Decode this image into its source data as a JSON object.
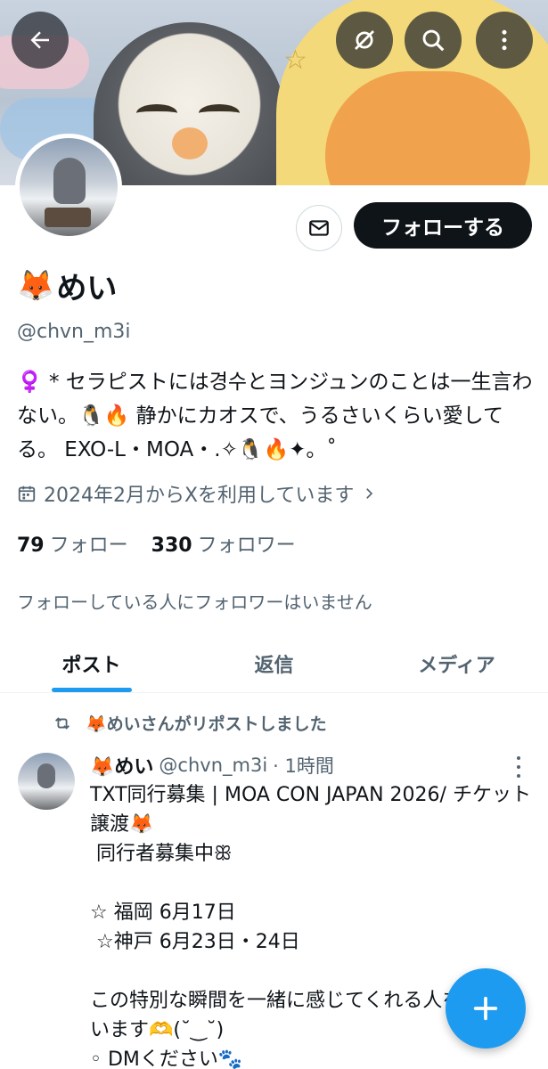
{
  "header": {
    "back_icon": "arrow-left-icon",
    "mute_icon": "slashed-circle-icon",
    "search_icon": "search-icon",
    "more_icon": "more-vertical-icon"
  },
  "profile": {
    "emoji": "🦊",
    "display_name": "めい",
    "handle": "@chvn_m3i",
    "follow_label": "フォローする",
    "message_icon": "mail-icon",
    "bio": "♀️ * セラピストには경수とヨンジュンのことは一生言わない。🐧🔥 静かにカオスで、うるさいくらい愛してる。 EXO-L・MOA・.✧🐧🔥✦。˚",
    "joined": "2024年2月からXを利用しています",
    "following_count": "79",
    "following_label": "フォロー",
    "followers_count": "330",
    "followers_label": "フォロワー",
    "no_mutual": "フォローしている人にフォロワーはいません"
  },
  "tabs": [
    {
      "label": "ポスト"
    },
    {
      "label": "返信"
    },
    {
      "label": "メディア"
    }
  ],
  "post": {
    "repost_text": "🦊めいさんがリポストしました",
    "author": "🦊めい",
    "handle": "@chvn_m3i",
    "time": "· 1時間",
    "body": "TXT同行募集 | MOA CON JAPAN 2026/ チケット譲渡🦊\n 同行者募集中ꕥ\n\n☆ 福岡 6月17日\n ☆神戸 6月23日・24日\n\nこの特別な瞬間を一緒に感じてくれる人を探しています🫶(˘‿˘)\n◦ DMください🐾"
  },
  "colors": {
    "accent": "#1d9bf0",
    "text": "#0f1419",
    "secondary": "#536471"
  }
}
